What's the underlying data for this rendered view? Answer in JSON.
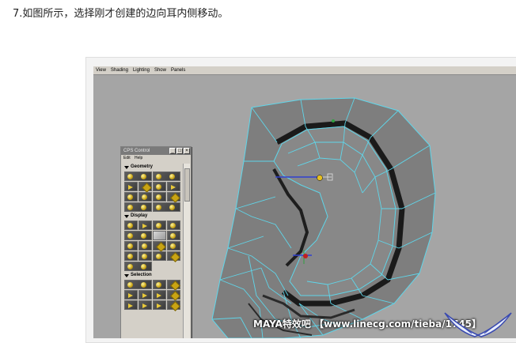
{
  "caption": "7.如图所示，选择刚才创建的边向耳内侧移动。",
  "viewport": {
    "menu": [
      "View",
      "Shading",
      "Lighting",
      "Show",
      "Panels"
    ]
  },
  "panel": {
    "title": "CPS Control",
    "menu": [
      "Edit",
      "Help"
    ],
    "sections": [
      {
        "label": "Geometry",
        "rows": 4
      },
      {
        "label": "Display",
        "rows": 5
      },
      {
        "label": "Selection",
        "rows": 3
      }
    ]
  },
  "watermark": "MAYA特效吧 【www.linecg.com/tieba/1745】",
  "colors": {
    "mesh": "#7e7e7e",
    "wire": "#5fd6ea",
    "viewport_bg": "#a5a5a5",
    "selected_edge": "#1a1a1a"
  }
}
